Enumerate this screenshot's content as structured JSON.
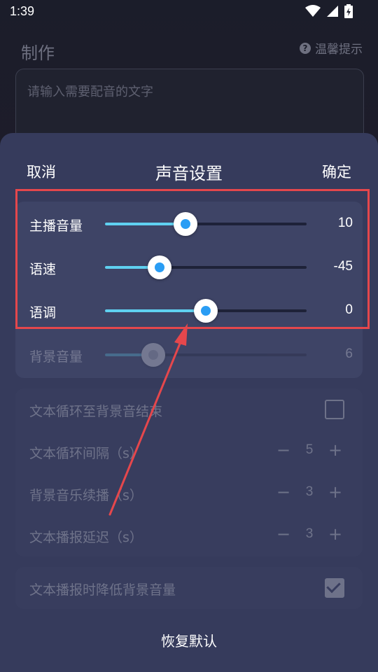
{
  "status_bar": {
    "time": "1:39"
  },
  "background_page": {
    "title": "制作",
    "tip": "温馨提示",
    "text_placeholder": "请输入需要配音的文字"
  },
  "sheet": {
    "cancel_label": "取消",
    "title": "声音设置",
    "confirm_label": "确定",
    "reset_label": "恢复默认"
  },
  "sliders": [
    {
      "label": "主播音量",
      "value": "10",
      "level": 0.4
    },
    {
      "label": "语速",
      "value": "-45",
      "level": 0.27
    },
    {
      "label": "语调",
      "value": "0",
      "level": 0.5
    },
    {
      "label": "背景音量",
      "value": "6",
      "level": 0.24,
      "disabled": true
    }
  ],
  "options": {
    "loop_to_bgm_end": {
      "label": "文本循环至背景音结束",
      "checked": false
    },
    "loop_interval": {
      "label": "文本循环间隔（s）",
      "value": "5",
      "minus": "−",
      "plus": "+"
    },
    "bgm_continue": {
      "label": "背景音乐续播（s）",
      "value": "3",
      "minus": "−",
      "plus": "+"
    },
    "broadcast_delay": {
      "label": "文本播报延迟（s）",
      "value": "3",
      "minus": "−",
      "plus": "+"
    },
    "duck_bgm": {
      "label": "文本播报时降低背景音量",
      "checked": true
    }
  },
  "colors": {
    "sheet_bg": "#363b5c",
    "card_bg": "#3e4466",
    "slider_fill": "#5fd0f0",
    "thumb_dot": "#2a9df4",
    "annotation_red": "#e5474c"
  }
}
